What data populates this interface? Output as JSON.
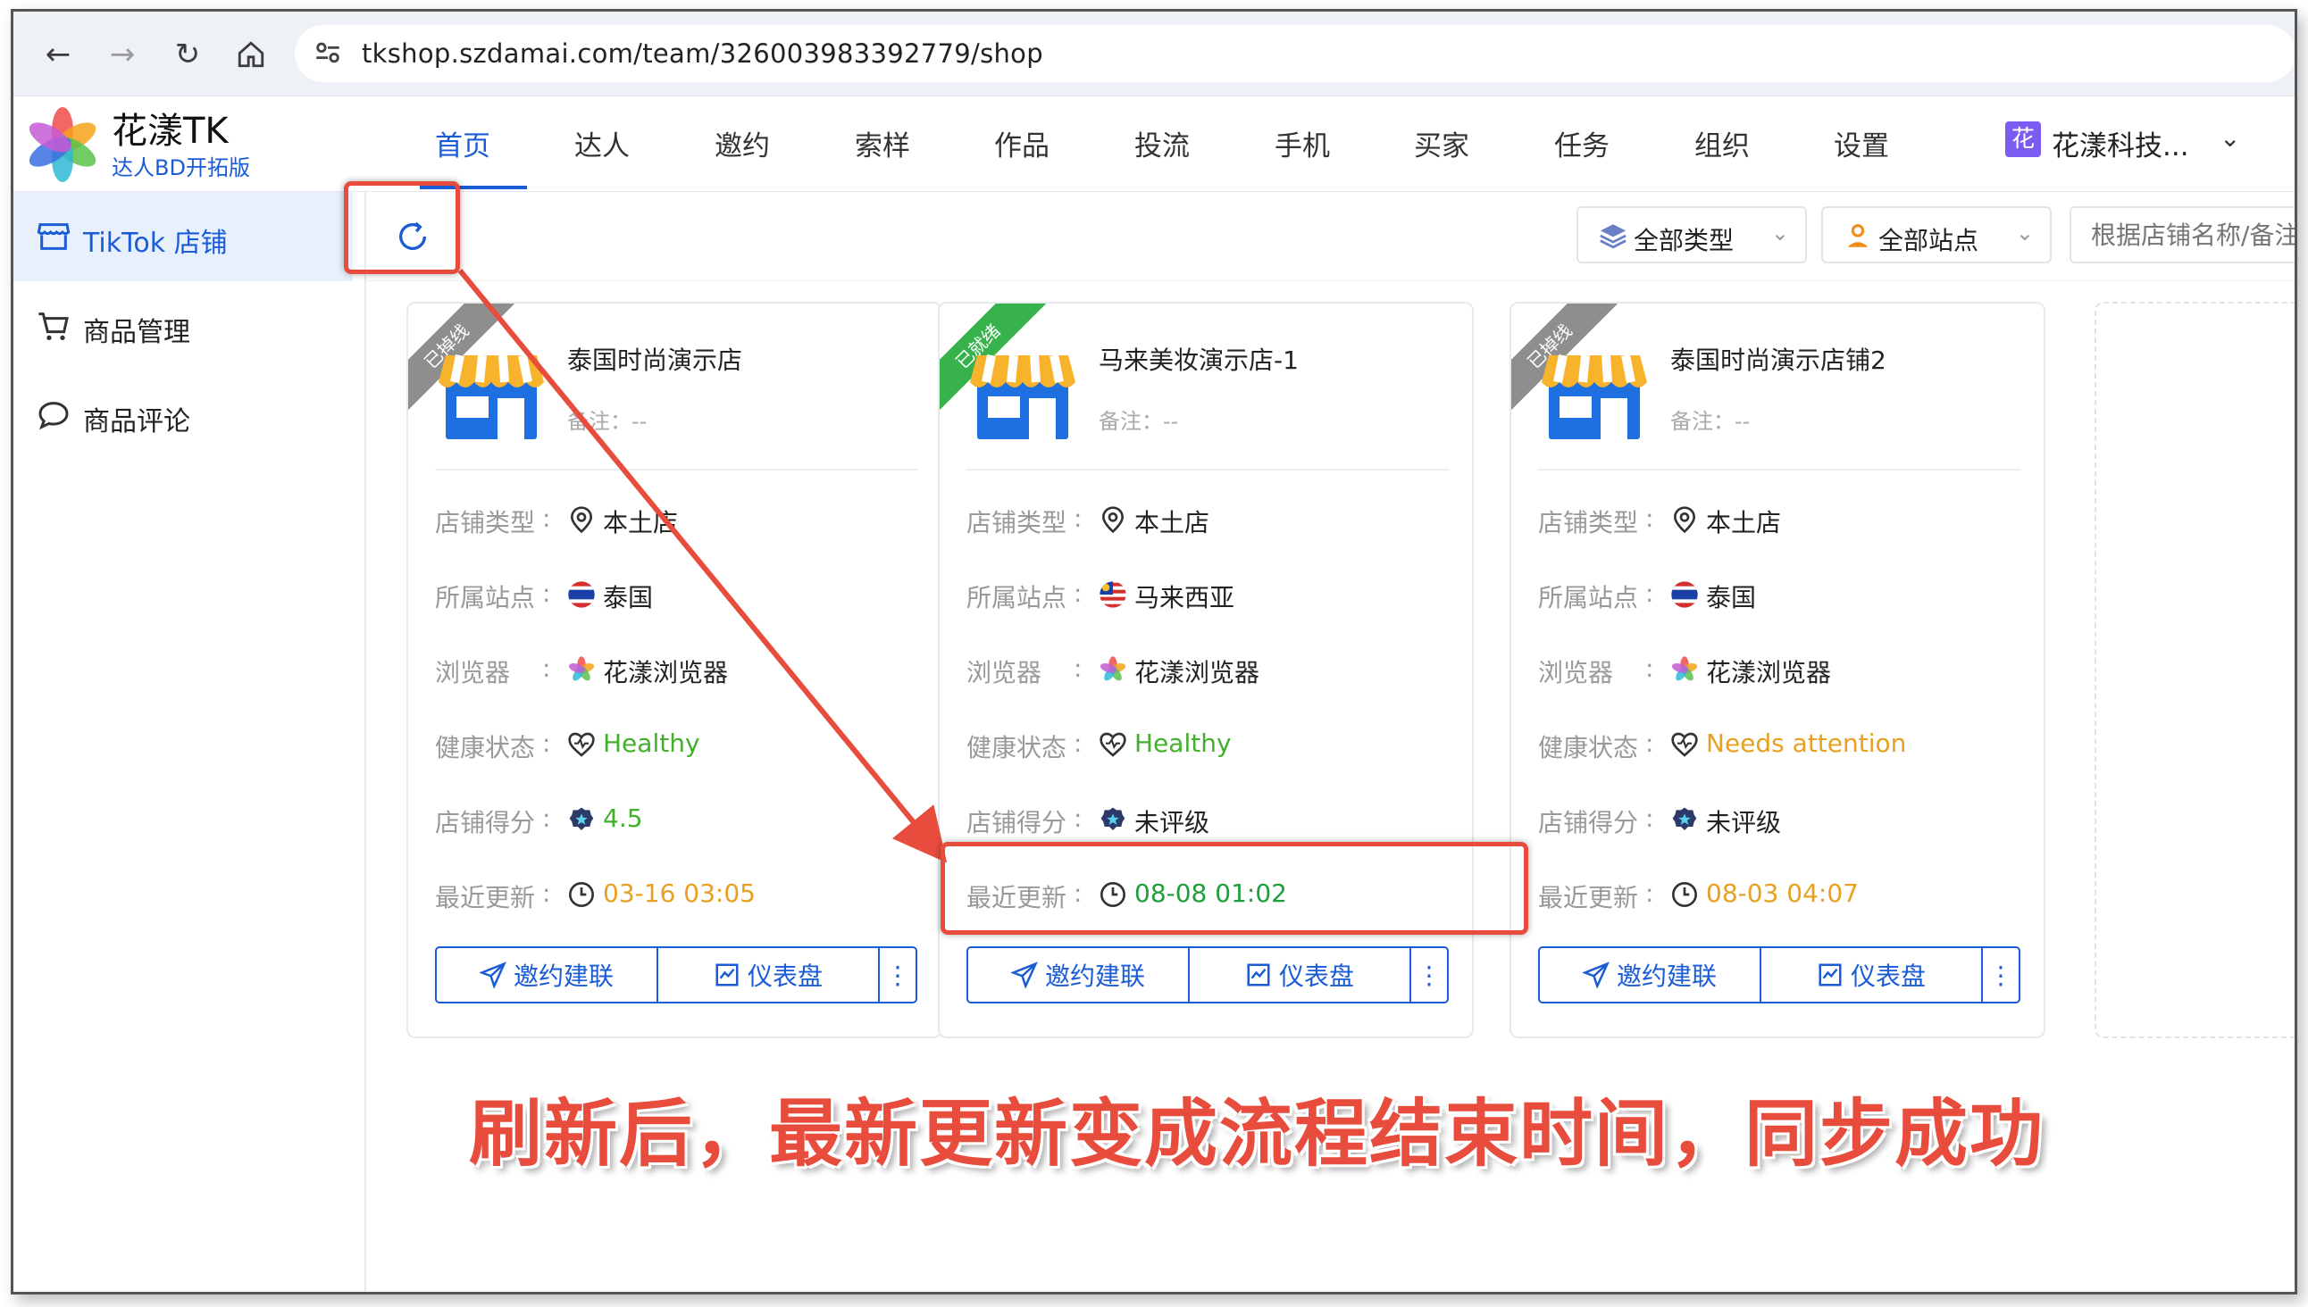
{
  "browser": {
    "url": "tkshop.szdamai.com/team/326003983392779/shop"
  },
  "brand": {
    "title": "花漾TK",
    "subtitle": "达人BD开拓版"
  },
  "menu": [
    "首页",
    "达人",
    "邀约",
    "索样",
    "作品",
    "投流",
    "手机",
    "买家",
    "任务",
    "组织",
    "设置"
  ],
  "org": {
    "badge": "花",
    "name": "花漾科技..."
  },
  "sidebar": {
    "items": [
      {
        "label": "TikTok 店铺"
      },
      {
        "label": "商品管理"
      },
      {
        "label": "商品评论"
      }
    ]
  },
  "toolbar": {
    "type_filter": "全部类型",
    "site_filter": "全部站点",
    "search_placeholder": "根据店铺名称/备注"
  },
  "labels": {
    "shop_type": "店铺类型",
    "site": "所属站点",
    "browser": "浏览器",
    "health": "健康状态",
    "score": "店铺得分",
    "updated": "最近更新",
    "colon": ":",
    "invite_btn": "邀约建联",
    "dashboard_btn": "仪表盘",
    "more_btn": "⋮"
  },
  "cards": [
    {
      "ribbon": "已掉线",
      "name": "泰国时尚演示店",
      "note": "备注：--",
      "shop_type": "本土店",
      "site": "泰国",
      "browser": "花漾浏览器",
      "health": "Healthy",
      "score": "4.5",
      "updated": "03-16 03:05"
    },
    {
      "ribbon": "已就绪",
      "name": "马来美妆演示店-1",
      "note": "备注：--",
      "shop_type": "本土店",
      "site": "马来西亚",
      "browser": "花漾浏览器",
      "health": "Healthy",
      "score": "未评级",
      "updated": "08-08 01:02"
    },
    {
      "ribbon": "已掉线",
      "name": "泰国时尚演示店铺2",
      "note": "备注：--",
      "shop_type": "本土店",
      "site": "泰国",
      "browser": "花漾浏览器",
      "health": "Needs attention",
      "score": "未评级",
      "updated": "08-03 04:07"
    }
  ],
  "annotation": {
    "caption": "刷新后，最新更新变成流程结束时间，同步成功"
  },
  "colors": {
    "accent": "#1a5bd6",
    "highlight": "#e84c3d",
    "healthy": "#43b02a",
    "warning": "#e8a020"
  }
}
